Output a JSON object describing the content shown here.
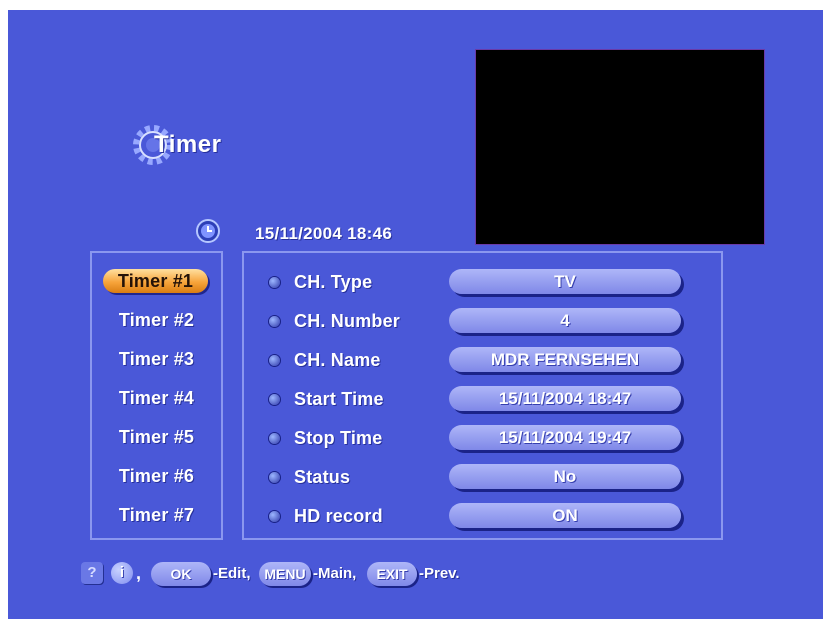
{
  "title": "Timer",
  "datetime": "15/11/2004 18:46",
  "timers": [
    {
      "label": "Timer #1",
      "selected": true
    },
    {
      "label": "Timer #2"
    },
    {
      "label": "Timer #3"
    },
    {
      "label": "Timer #4"
    },
    {
      "label": "Timer #5"
    },
    {
      "label": "Timer #6"
    },
    {
      "label": "Timer #7"
    }
  ],
  "fields": [
    {
      "label": "CH. Type",
      "value": "TV"
    },
    {
      "label": "CH. Number",
      "value": "4"
    },
    {
      "label": "CH. Name",
      "value": "MDR FERNSEHEN"
    },
    {
      "label": "Start Time",
      "value": "15/11/2004 18:47"
    },
    {
      "label": "Stop Time",
      "value": "15/11/2004 19:47"
    },
    {
      "label": "Status",
      "value": "No"
    },
    {
      "label": "HD record",
      "value": "ON"
    }
  ],
  "footer": {
    "help_symbol": "?",
    "info_symbol": "i",
    "separator": ",",
    "ok_key": "OK",
    "ok_text": "-Edit,",
    "menu_key": "MENU",
    "menu_text": "-Main,",
    "exit_key": "EXIT",
    "exit_text": "-Prev."
  },
  "colors": {
    "background": "#4a58d8",
    "selected": "#f7a43b",
    "pill": "#8f98ee",
    "video": "#000000"
  },
  "icons": {
    "title": "gear-icon",
    "datetime": "clock-icon",
    "help": "help-icon",
    "info": "info-icon"
  }
}
